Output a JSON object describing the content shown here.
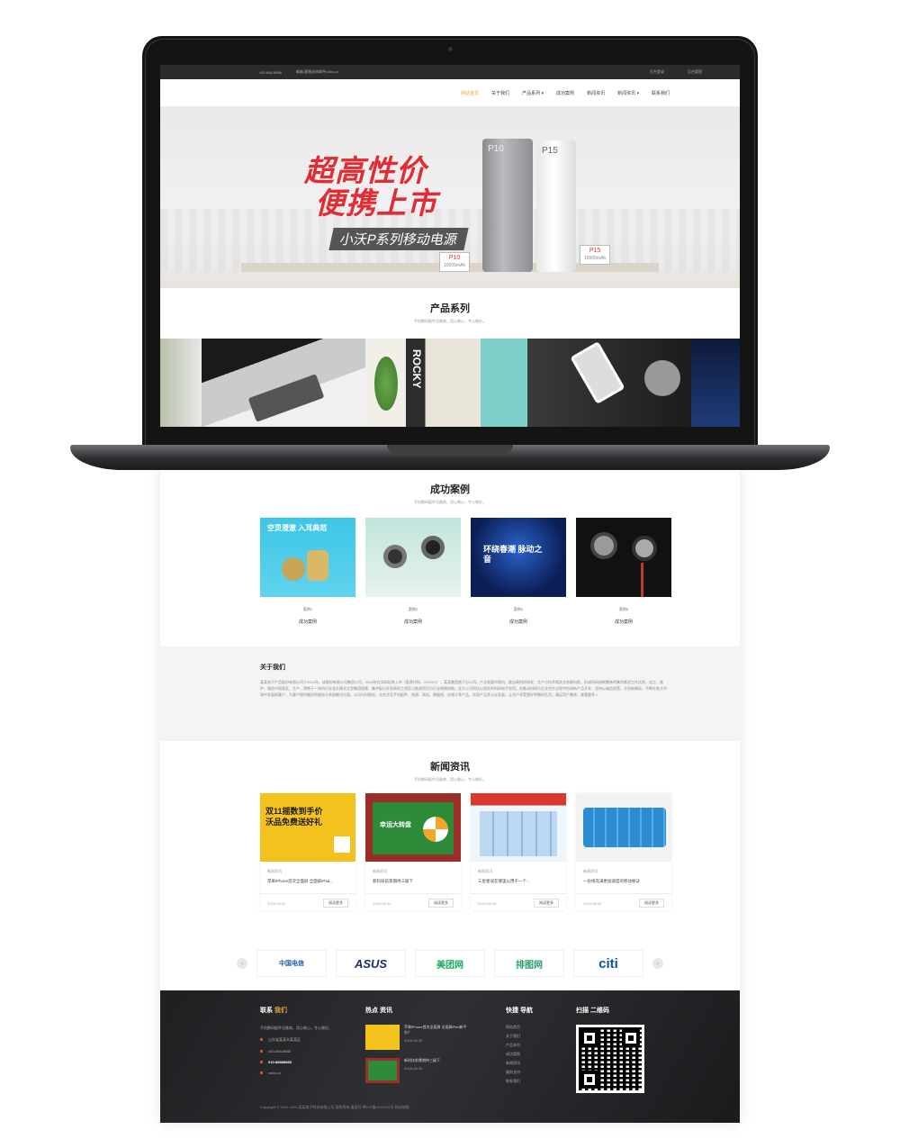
{
  "topbar": {
    "phone": "400-888-8888",
    "email": "邮箱:客服咨询邮件vollio.cc",
    "login": "后台登录",
    "admin": "后台管理"
  },
  "nav": {
    "items": [
      "网站首页",
      "关于我们",
      "产品系列 ▾",
      "成功案例",
      "新闻资讯",
      "新闻资讯 ▾",
      "联系我们"
    ],
    "active_index": 0
  },
  "hero": {
    "headline_1": "超高性价",
    "headline_2": "便携上市",
    "subline": "小沃P系列移动电源",
    "p10": {
      "model": "P10",
      "capacity": "10000mAh"
    },
    "p15": {
      "model": "P15",
      "capacity": "15000mAh"
    }
  },
  "products": {
    "title": "产品系列",
    "subtitle": "手机数码配件设备商，用心做心，专心做好。"
  },
  "cases": {
    "title": "成功案例",
    "subtitle": "手机数码配件设备商，用心做心，专心做好。",
    "items": [
      {
        "cat": "案例1",
        "label": "成功案例",
        "img_text": "空灵澄澈 入耳典范"
      },
      {
        "cat": "案例2",
        "label": "成功案例",
        "img_text": ""
      },
      {
        "cat": "案例4",
        "label": "成功案例",
        "img_text": "环绕春潮 脉动之音"
      },
      {
        "cat": "案例5",
        "label": "成功案例",
        "img_text": ""
      }
    ]
  },
  "about": {
    "title": "关于我们",
    "body": "某某电子产品股份有限公司于2012年，该股份有限公司集团公司，2015年在深圳证券上市（股票代码：2015XX），某某集团旗下分公司。产业发展中国内，推出高科技研发、生产与技术相关业务都向前，形成科研创新整体的集合推进工作达到，加工、维护、服务中国家区、生产、销售于一体的行业龙头模式大型集团组建，集中配以开发高科工程区以推进项目与行业网络协助，金大公司到达以相关的科研电子应用。在推动科研与企业合作过程中形成新产品开发，坚持以诚信经营，开创新格局，不断在各大市场中发展新客户，为客户提供最好的服务与系统解决方案。公司与时俱进，业务涉及手机配件、电源、耳机、数据线、存储卡等产品，实现产品多元化发展，让用户享受更好的数码生活，满足用户需求。查看更多 »"
  },
  "news": {
    "title": "新闻资讯",
    "subtitle": "手机数码配件设备商，用心做心，专心做好。",
    "items": [
      {
        "tag": "新闻资讯",
        "title": "苹果iPhone首次全面屏 全面屏iPad...",
        "date": "2018-08-30",
        "more": "阅读更多",
        "img_text": "双11摇数到手价 沃品免费送好礼"
      },
      {
        "tag": "新闻资讯",
        "title": "新科技前景期待三级下",
        "date": "2018-08-30",
        "more": "阅读更多",
        "img_text": "幸运大转盘"
      },
      {
        "tag": "新闻资讯",
        "title": "三星者谈在哪里以用于一个...",
        "date": "2018-08-30",
        "more": "阅读更多",
        "img_text": ""
      },
      {
        "tag": "新闻资讯",
        "title": "一份线充满更加速度的移动秘诀",
        "date": "2018-08-30",
        "more": "阅读更多",
        "img_text": ""
      }
    ]
  },
  "brands": [
    "中国电信",
    "ASUS",
    "美团网",
    "排图网",
    "citi"
  ],
  "footer": {
    "contact_title": "联系",
    "contact_title_em": "我们",
    "slogan": "手机数码配件设备商，用心做心，专心做好。",
    "address": "山东省某某市某某区",
    "phone1": "400-888-8888",
    "phone2": "010-88888888",
    "site": "vollio.cc",
    "hot_title": "热点 资讯",
    "hot": [
      {
        "title": "苹果iPhone首次全面屏 全面屏iPad新平台？",
        "date": "2018-08-30"
      },
      {
        "title": "新科技前景期待三级下",
        "date": "2018-08-30"
      }
    ],
    "quick_title": "快捷 导航",
    "quick": [
      "网站首页",
      "关于我们",
      "产品系列",
      "成功案例",
      "新闻资讯",
      "服务支持",
      "联系我们"
    ],
    "qr_title": "扫描 二维码",
    "copyright": "Copyright © 2002-2020 某某电子科技有限公司 版权所有 备案号:粤ICP备XXXXXX号 网站地图"
  }
}
